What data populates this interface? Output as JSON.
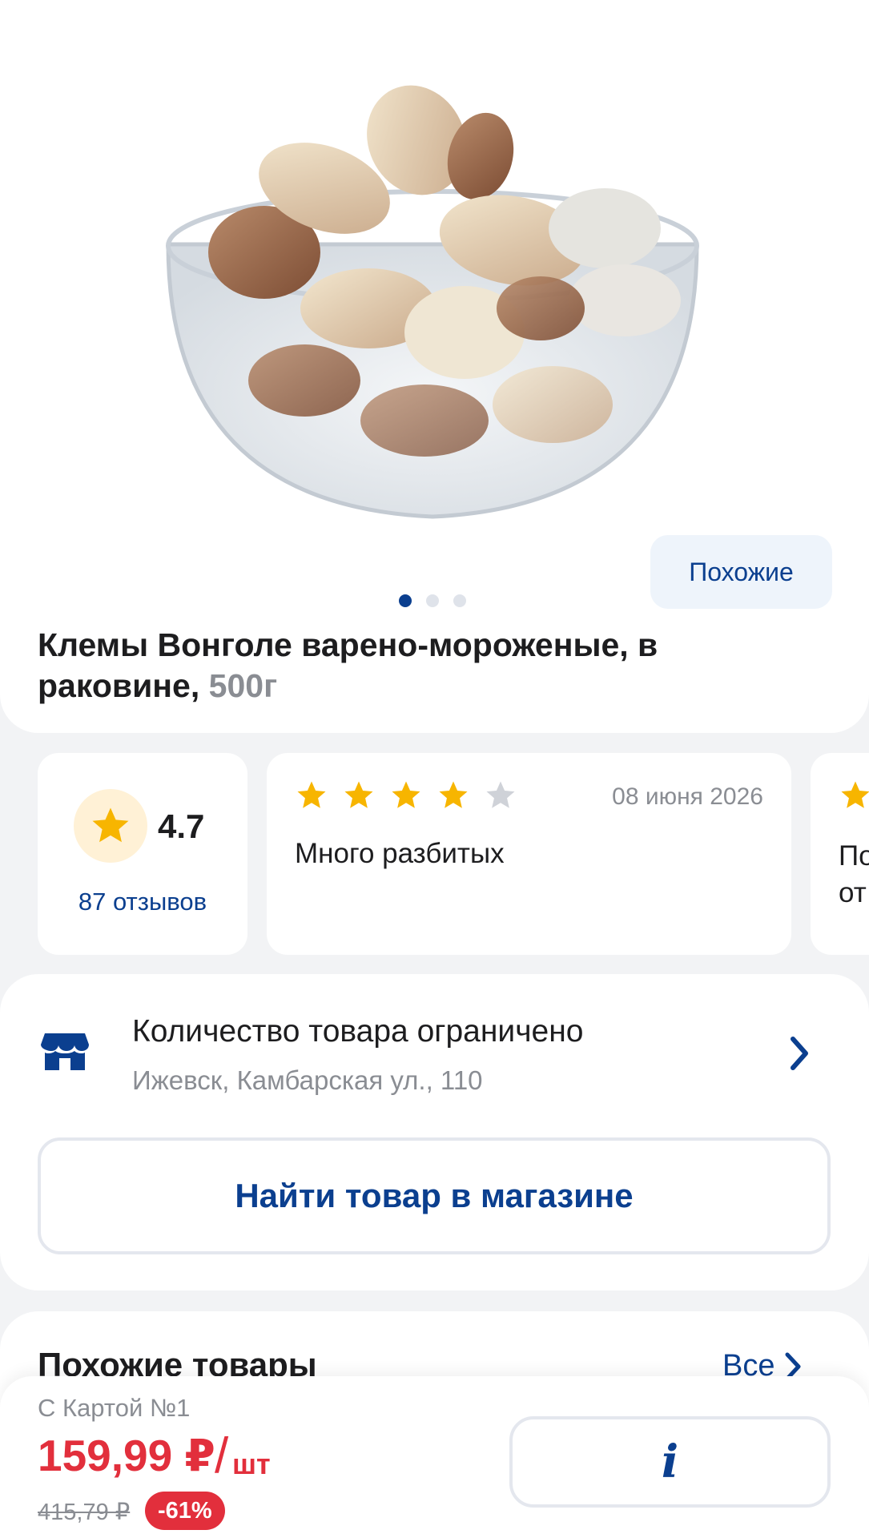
{
  "gallery": {
    "similar_label": "Похожие",
    "dots": 3,
    "active_dot": 0
  },
  "product": {
    "title": "Клемы Вонголе варено-мороженые, в раковине,",
    "weight": "500г"
  },
  "rating": {
    "value": "4.7",
    "reviews_count": "87 отзывов",
    "icon": "star-icon"
  },
  "reviews": [
    {
      "stars": 4,
      "max_stars": 5,
      "date": "08 июня 2026",
      "text": "Много разбитых"
    },
    {
      "text": "По\nот"
    }
  ],
  "store": {
    "title": "Количество товара ограничено",
    "address": "Ижевск, Камбарская ул., 110",
    "find_button": "Найти товар в магазине",
    "icon": "store-icon"
  },
  "similar_section": {
    "title": "Похожие товары",
    "all_label": "Все"
  },
  "bottom_bar": {
    "card_label": "С Картой №1",
    "price": "159,99 ₽",
    "slash": "/",
    "unit": "шт",
    "old_price": "415,79 ₽",
    "discount": "-61%",
    "info_label": "i"
  },
  "colors": {
    "accent_blue": "#0b3f8f",
    "price_red": "#e22f3c",
    "star_yellow": "#f7b500",
    "star_gray": "#cfd2d8",
    "background": "#f2f3f5"
  }
}
